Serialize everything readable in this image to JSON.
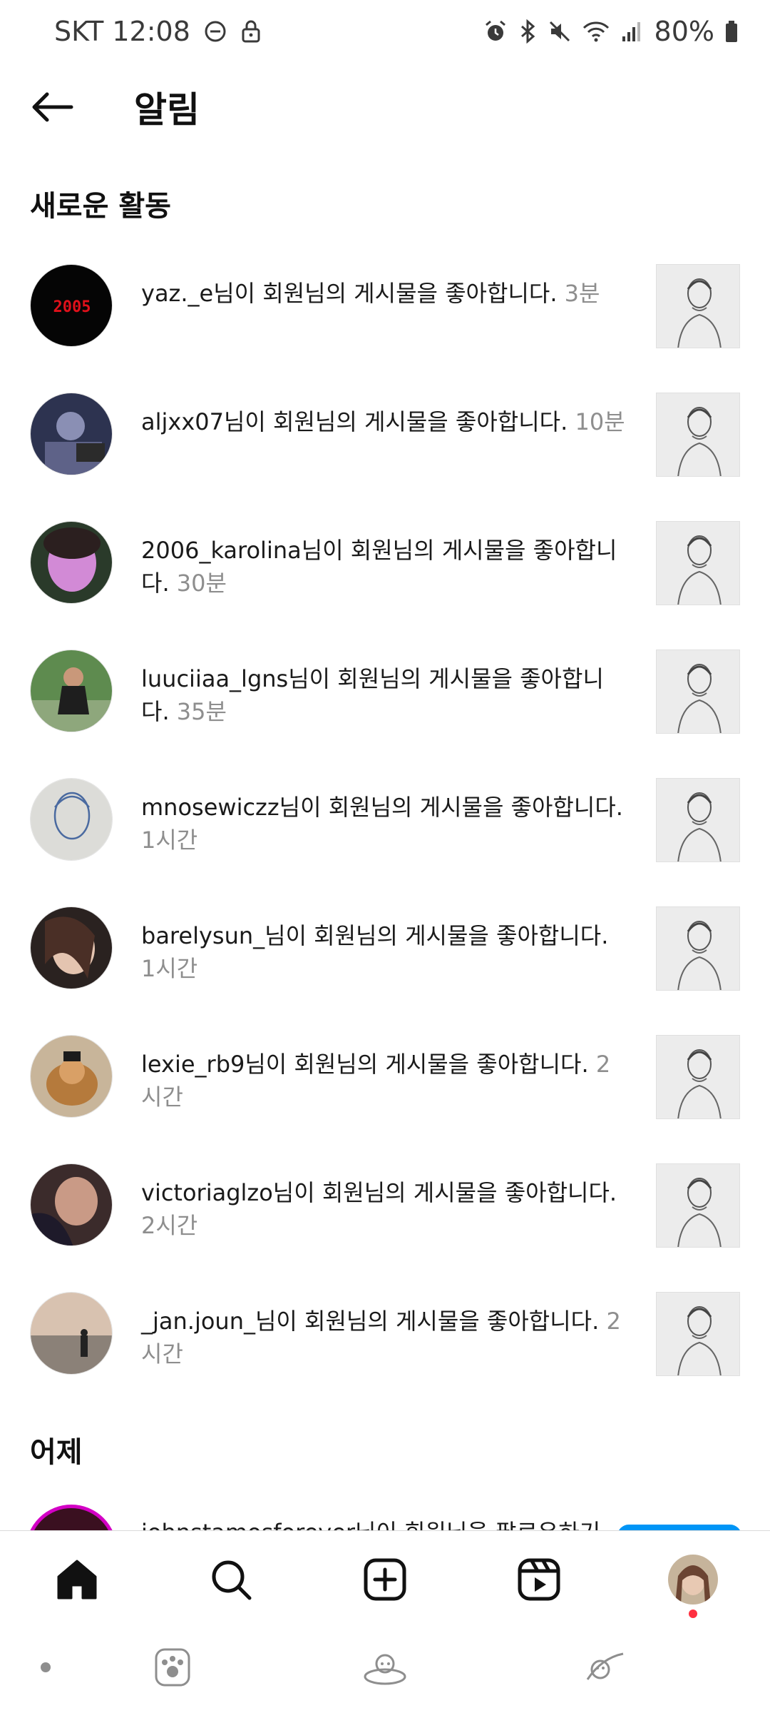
{
  "status_bar": {
    "carrier_time": "SKT 12:08",
    "battery": "80%"
  },
  "header": {
    "title": "알림",
    "back_icon": "arrow-left-icon"
  },
  "sections": {
    "new_activity": "새로운 활동",
    "yesterday": "어제"
  },
  "notifications": [
    {
      "text": "yaz._e님이 회원님의 게시물을 좋아합니다.",
      "time": "3분"
    },
    {
      "text": "aljxx07님이 회원님의 게시물을 좋아합니다.",
      "time": "10분"
    },
    {
      "text": "2006_karolina님이 회원님의 게시물을 좋아합니다.",
      "time": "30분"
    },
    {
      "text": "luuciiaa_lgns님이 회원님의 게시물을 좋아합니다.",
      "time": "35분"
    },
    {
      "text": "mnosewiczz님이 회원님의 게시물을 좋아합니다.",
      "time": "1시간"
    },
    {
      "text": "barelysun_님이 회원님의 게시물을 좋아합니다.",
      "time": "1시간"
    },
    {
      "text": "lexie_rb9님이 회원님의 게시물을 좋아합니다.",
      "time": "2시간"
    },
    {
      "text": "victoriaglzo님이 회원님의 게시물을 좋아합니다.",
      "time": "2시간"
    },
    {
      "text": "_jan.joun_님이 회원님의 게시물을 좋아합니다.",
      "time": "2시간"
    }
  ],
  "partial_notification": {
    "text": "johnstamosforever님이 회원님을 팔로우하기"
  },
  "bottom_nav": {
    "items": [
      "home-icon",
      "search-icon",
      "create-icon",
      "reels-icon",
      "profile-avatar"
    ]
  },
  "colors": {
    "accent": "#0095f6",
    "badge": "#ff3040",
    "secondary_text": "#8e8e8e"
  }
}
